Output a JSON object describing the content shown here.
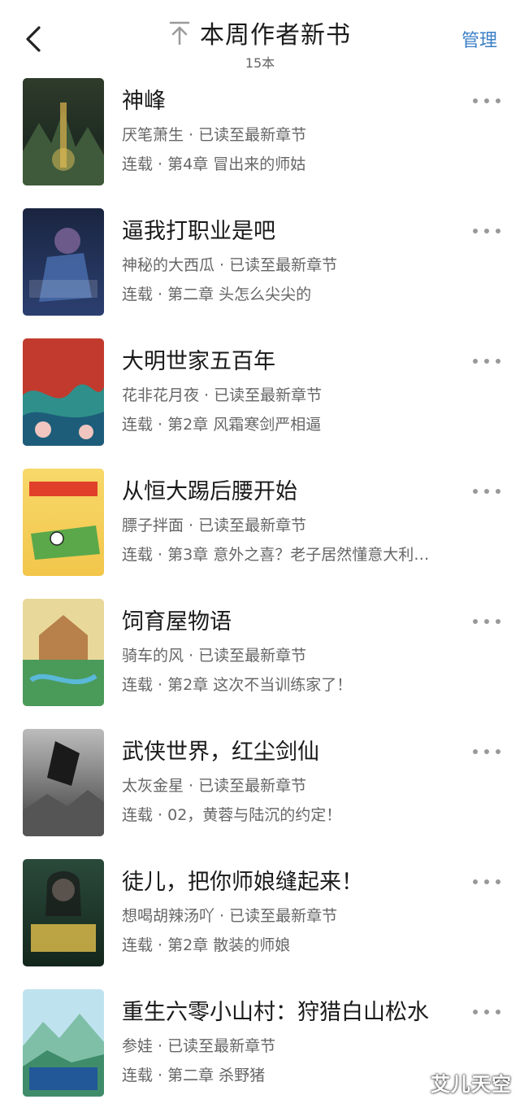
{
  "header": {
    "back_icon": "chevron-left-icon",
    "pin_icon": "pin-top-icon",
    "title": "本周作者新书",
    "count": "15本",
    "manage_label": "管理"
  },
  "books": [
    {
      "title": "神峰",
      "meta": "厌笔萧生 · 已读至最新章节",
      "chapter": "连载 · 第4章 冒出来的师姑",
      "cover_colors": [
        "#1e2b22",
        "#c9a64a"
      ]
    },
    {
      "title": "逼我打职业是吧",
      "meta": "神秘的大西瓜 · 已读至最新章节",
      "chapter": "连载 · 第二章 头怎么尖尖的",
      "cover_colors": [
        "#1a2540",
        "#4a6fb0"
      ]
    },
    {
      "title": "大明世家五百年",
      "meta": "花非花月夜 · 已读至最新章节",
      "chapter": "连载 · 第2章 风霜寒剑严相逼",
      "cover_colors": [
        "#c23a2e",
        "#2f8f8a"
      ]
    },
    {
      "title": "从恒大踢后腰开始",
      "meta": "膘子拌面 · 已读至最新章节",
      "chapter": "连载 · 第3章 意外之喜？老子居然懂意大利…",
      "cover_colors": [
        "#f2c64a",
        "#5aa84a"
      ]
    },
    {
      "title": "饲育屋物语",
      "meta": "骑车的风 · 已读至最新章节",
      "chapter": "连载 · 第2章 这次不当训练家了！",
      "cover_colors": [
        "#e8d89a",
        "#4a9a5a"
      ]
    },
    {
      "title": "武侠世界，红尘剑仙",
      "meta": "太灰金星 · 已读至最新章节",
      "chapter": "连载 · 02，黄蓉与陆沉的约定！",
      "cover_colors": [
        "#3a3a3a",
        "#bdbdbd"
      ]
    },
    {
      "title": "徒儿，把你师娘缝起来！",
      "meta": "想喝胡辣汤吖 · 已读至最新章节",
      "chapter": "连载 · 第2章 散装的师娘",
      "cover_colors": [
        "#1e3a2a",
        "#d8b84a"
      ]
    },
    {
      "title": "重生六零小山村：狩猎白山松水",
      "meta": "参娃 · 已读至最新章节",
      "chapter": "连载 · 第二章 杀野猪",
      "cover_colors": [
        "#bfe3ee",
        "#3f8c6a"
      ]
    }
  ],
  "more_icon": "more-dots-icon",
  "watermark": "艾儿天空"
}
